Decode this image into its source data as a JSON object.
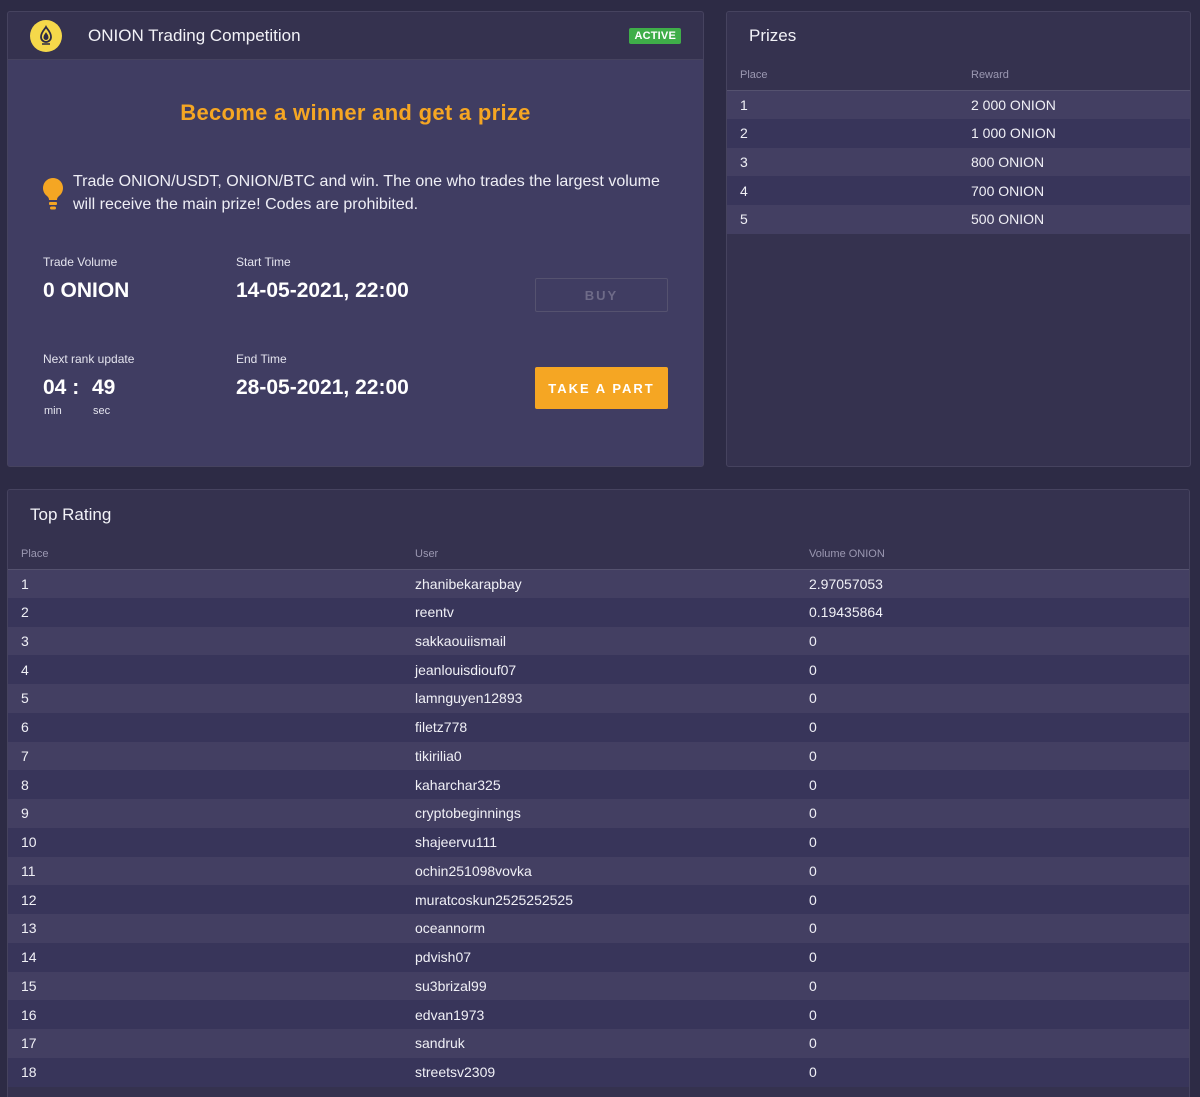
{
  "competition": {
    "title": "ONION Trading Competition",
    "status_badge": "ACTIVE",
    "headline": "Become a winner and get a prize",
    "description": "Trade ONION/USDT, ONION/BTC and win. The one who trades the largest volume will receive the main prize! Codes are prohibited.",
    "trade_volume_label": "Trade Volume",
    "trade_volume_value": "0 ONION",
    "start_time_label": "Start Time",
    "start_time_value": "14-05-2021, 22:00",
    "next_rank_label": "Next rank update",
    "countdown_min": "04 :",
    "countdown_sec": "49",
    "min_label": "min",
    "sec_label": "sec",
    "end_time_label": "End Time",
    "end_time_value": "28-05-2021, 22:00",
    "buy_label": "BUY",
    "take_part_label": "TAKE A PART",
    "logo_icon": "onion-logo-icon",
    "bulb_icon": "lightbulb-icon",
    "accent_color": "#f5a623",
    "badge_color": "#3fae49"
  },
  "prizes": {
    "title": "Prizes",
    "columns": [
      "Place",
      "Reward"
    ],
    "rows": [
      [
        "1",
        "2 000 ONION"
      ],
      [
        "2",
        "1 000 ONION"
      ],
      [
        "3",
        "800 ONION"
      ],
      [
        "4",
        "700 ONION"
      ],
      [
        "5",
        "500 ONION"
      ]
    ]
  },
  "rating": {
    "title": "Top Rating",
    "columns": [
      "Place",
      "User",
      "Volume ONION"
    ],
    "rows": [
      [
        "1",
        "zhanibekarapbay",
        "2.97057053"
      ],
      [
        "2",
        "reentv",
        "0.19435864"
      ],
      [
        "3",
        "sakkaouiismail",
        "0"
      ],
      [
        "4",
        "jeanlouisdiouf07",
        "0"
      ],
      [
        "5",
        "lamnguyen12893",
        "0"
      ],
      [
        "6",
        "filetz778",
        "0"
      ],
      [
        "7",
        "tikirilia0",
        "0"
      ],
      [
        "8",
        "kaharchar325",
        "0"
      ],
      [
        "9",
        "cryptobeginnings",
        "0"
      ],
      [
        "10",
        "shajeervu111",
        "0"
      ],
      [
        "11",
        "ochin251098vovka",
        "0"
      ],
      [
        "12",
        "muratcoskun2525252525",
        "0"
      ],
      [
        "13",
        "oceannorm",
        "0"
      ],
      [
        "14",
        "pdvish07",
        "0"
      ],
      [
        "15",
        "su3brizal99",
        "0"
      ],
      [
        "16",
        "edvan1973",
        "0"
      ],
      [
        "17",
        "sandruk",
        "0"
      ],
      [
        "18",
        "streetsv2309",
        "0"
      ]
    ]
  }
}
